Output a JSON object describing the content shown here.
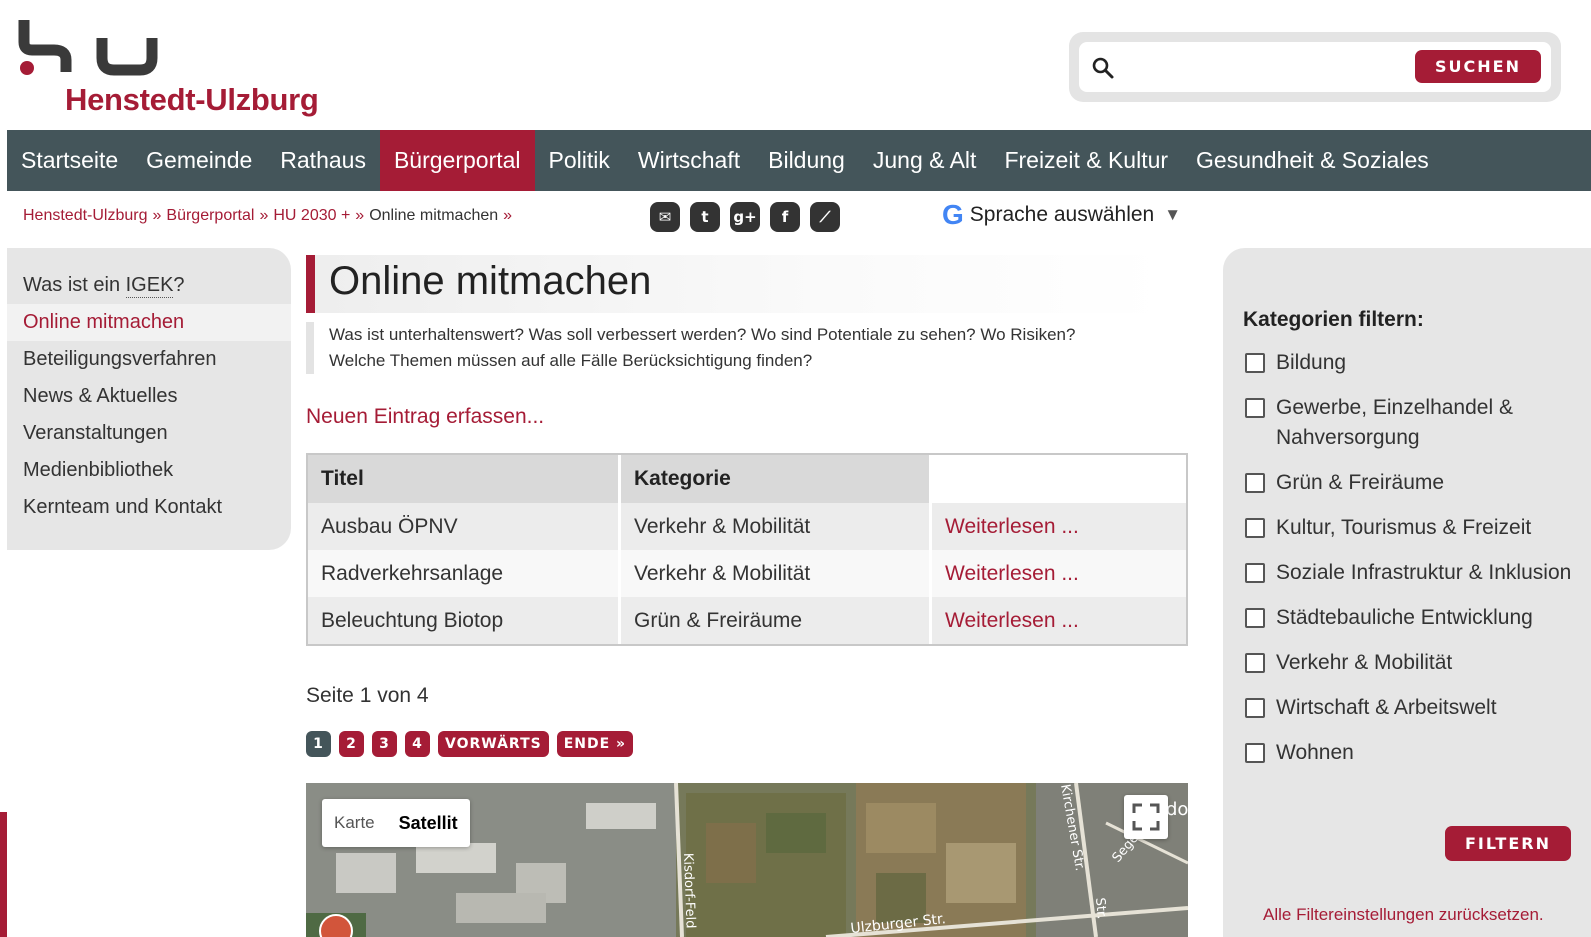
{
  "site": {
    "name": "Henstedt-Ulzburg",
    "brand_color": "#a51c36",
    "nav_bg_color": "#44555a"
  },
  "search": {
    "value": "",
    "placeholder": "",
    "button_label": "SUCHEN",
    "icon": "search-icon"
  },
  "nav": {
    "items": [
      {
        "label": "Startseite",
        "active": false
      },
      {
        "label": "Gemeinde",
        "active": false
      },
      {
        "label": "Rathaus",
        "active": false
      },
      {
        "label": "Bürgerportal",
        "active": true
      },
      {
        "label": "Politik",
        "active": false
      },
      {
        "label": "Wirtschaft",
        "active": false
      },
      {
        "label": "Bildung",
        "active": false
      },
      {
        "label": "Jung & Alt",
        "active": false
      },
      {
        "label": "Freizeit & Kultur",
        "active": false
      },
      {
        "label": "Gesundheit & Soziales",
        "active": false
      }
    ]
  },
  "breadcrumb": {
    "items": [
      "Henstedt-Ulzburg",
      "Bürgerportal",
      "HU 2030 +"
    ],
    "separator": "»",
    "current": "Online mitmachen"
  },
  "share": {
    "icons": [
      "mail-icon",
      "twitter-icon",
      "google-plus-icon",
      "facebook-icon",
      "rss-icon"
    ],
    "glyphs": [
      "✉",
      "t",
      "g+",
      "f",
      "⟋"
    ]
  },
  "translate": {
    "g_glyph": "G",
    "label": "Sprache auswählen",
    "arrow": "▼"
  },
  "sidebar": {
    "items": [
      {
        "prefix": "Was ist ein ",
        "abbr": "IGEK",
        "suffix": "?",
        "active": false
      },
      {
        "label": "Online mitmachen",
        "active": true
      },
      {
        "label": "Beteiligungsverfahren",
        "active": false
      },
      {
        "label": "News & Aktuelles",
        "active": false
      },
      {
        "label": "Veranstaltungen",
        "active": false
      },
      {
        "label": "Medienbibliothek",
        "active": false
      },
      {
        "label": "Kernteam und Kontakt",
        "active": false
      }
    ]
  },
  "main": {
    "title": "Online mitmachen",
    "intro_line1": "Was ist unterhaltenswert? Was soll verbessert werden? Wo sind Potentiale zu sehen? Wo Risiken?",
    "intro_line2": "Welche Themen müssen auf alle Fälle Berücksichtigung finden?",
    "new_entry_link": "Neuen Eintrag erfassen...",
    "table": {
      "headers": [
        "Titel",
        "Kategorie",
        ""
      ],
      "rows": [
        {
          "title": "Ausbau ÖPNV",
          "category": "Verkehr & Mobilität",
          "action": "Weiterlesen ..."
        },
        {
          "title": "Radverkehrsanlage",
          "category": "Verkehr & Mobilität",
          "action": "Weiterlesen ..."
        },
        {
          "title": "Beleuchtung Biotop",
          "category": "Grün & Freiräume",
          "action": "Weiterlesen ..."
        }
      ]
    },
    "page_info": "Seite 1 von 4",
    "pagination": {
      "pages": [
        "1",
        "2",
        "3",
        "4"
      ],
      "current_page": "1",
      "next_label": "VORWÄRTS",
      "end_label": "ENDE »"
    },
    "map": {
      "type_options": [
        "Karte",
        "Satellit"
      ],
      "selected_type": "Satellit",
      "street_labels": [
        "Kisdorf-Feld",
        "Ulzburger Str.",
        "Kirchener Str.",
        "Segeberger",
        "Str.",
        "do"
      ],
      "fullscreen_icon": "fullscreen-icon"
    }
  },
  "filter": {
    "title": "Kategorien filtern:",
    "categories": [
      {
        "label": "Bildung",
        "checked": false
      },
      {
        "label": "Gewerbe, Einzelhandel & Nahversorgung",
        "checked": false
      },
      {
        "label": "Grün & Freiräume",
        "checked": false
      },
      {
        "label": "Kultur, Tourismus & Freizeit",
        "checked": false
      },
      {
        "label": "Soziale Infrastruktur & Inklusion",
        "checked": false
      },
      {
        "label": "Städtebauliche Entwicklung",
        "checked": false
      },
      {
        "label": "Verkehr & Mobilität",
        "checked": false
      },
      {
        "label": "Wirtschaft & Arbeitswelt",
        "checked": false
      },
      {
        "label": "Wohnen",
        "checked": false
      }
    ],
    "button_label": "FILTERN",
    "reset_link": "Alle Filtereinstellungen zurücksetzen."
  }
}
